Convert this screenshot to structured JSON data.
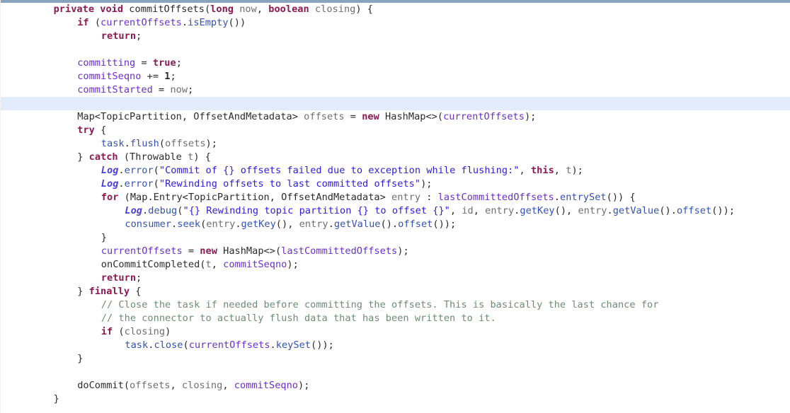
{
  "editor": {
    "language": "java",
    "method_name": "commitOffsets",
    "caret_line_index": 7,
    "colors": {
      "background": "#ffffff",
      "caret_line_highlight": "#e3ecfa",
      "top_strip": "#8aa4bd",
      "keyword": "#8a1a50",
      "field": "#6a31c9",
      "static_field": "#4b3fd6",
      "identifier": "#3451b2",
      "local_variable": "#6f6f6f",
      "string": "#2f20d6",
      "comment": "#6e8b74",
      "plain_text": "#2b2b2b"
    }
  },
  "lines": [
    {
      "id": 0,
      "indent": 1,
      "highlight": false,
      "tokens": [
        {
          "t": "private",
          "c": "kw"
        },
        {
          "t": " ",
          "c": "plain"
        },
        {
          "t": "void",
          "c": "kw"
        },
        {
          "t": " ",
          "c": "plain"
        },
        {
          "t": "commitOffsets",
          "c": "plain"
        },
        {
          "t": "(",
          "c": "plain"
        },
        {
          "t": "long",
          "c": "kw"
        },
        {
          "t": " ",
          "c": "plain"
        },
        {
          "t": "now",
          "c": "local"
        },
        {
          "t": ", ",
          "c": "plain"
        },
        {
          "t": "boolean",
          "c": "kw"
        },
        {
          "t": " ",
          "c": "plain"
        },
        {
          "t": "closing",
          "c": "local"
        },
        {
          "t": ") {",
          "c": "plain"
        }
      ]
    },
    {
      "id": 1,
      "indent": 2,
      "highlight": false,
      "tokens": [
        {
          "t": "if",
          "c": "kw"
        },
        {
          "t": " (",
          "c": "plain"
        },
        {
          "t": "currentOffsets",
          "c": "field"
        },
        {
          "t": ".",
          "c": "plain"
        },
        {
          "t": "isEmpty",
          "c": "ident"
        },
        {
          "t": "())",
          "c": "plain"
        }
      ]
    },
    {
      "id": 2,
      "indent": 3,
      "highlight": false,
      "tokens": [
        {
          "t": "return",
          "c": "kw"
        },
        {
          "t": ";",
          "c": "plain"
        }
      ]
    },
    {
      "id": 3,
      "indent": 0,
      "highlight": false,
      "tokens": []
    },
    {
      "id": 4,
      "indent": 2,
      "highlight": false,
      "tokens": [
        {
          "t": "committing",
          "c": "field"
        },
        {
          "t": " = ",
          "c": "plain"
        },
        {
          "t": "true",
          "c": "kw"
        },
        {
          "t": ";",
          "c": "plain"
        }
      ]
    },
    {
      "id": 5,
      "indent": 2,
      "highlight": false,
      "tokens": [
        {
          "t": "commitSeqno",
          "c": "field"
        },
        {
          "t": " += ",
          "c": "plain"
        },
        {
          "t": "1",
          "c": "num"
        },
        {
          "t": ";",
          "c": "plain"
        }
      ]
    },
    {
      "id": 6,
      "indent": 2,
      "highlight": false,
      "tokens": [
        {
          "t": "commitStarted",
          "c": "field"
        },
        {
          "t": " = ",
          "c": "plain"
        },
        {
          "t": "now",
          "c": "local"
        },
        {
          "t": ";",
          "c": "plain"
        }
      ]
    },
    {
      "id": 7,
      "indent": 0,
      "highlight": true,
      "tokens": []
    },
    {
      "id": 8,
      "indent": 2,
      "highlight": false,
      "tokens": [
        {
          "t": "Map<TopicPartition, OffsetAndMetadata> ",
          "c": "plain"
        },
        {
          "t": "offsets",
          "c": "local"
        },
        {
          "t": " = ",
          "c": "plain"
        },
        {
          "t": "new",
          "c": "kw"
        },
        {
          "t": " HashMap<>(",
          "c": "plain"
        },
        {
          "t": "currentOffsets",
          "c": "field"
        },
        {
          "t": ");",
          "c": "plain"
        }
      ]
    },
    {
      "id": 9,
      "indent": 2,
      "highlight": false,
      "tokens": [
        {
          "t": "try",
          "c": "kw"
        },
        {
          "t": " {",
          "c": "plain"
        }
      ]
    },
    {
      "id": 10,
      "indent": 3,
      "highlight": false,
      "tokens": [
        {
          "t": "task",
          "c": "ident"
        },
        {
          "t": ".",
          "c": "plain"
        },
        {
          "t": "flush",
          "c": "ident"
        },
        {
          "t": "(",
          "c": "plain"
        },
        {
          "t": "offsets",
          "c": "local"
        },
        {
          "t": ");",
          "c": "plain"
        }
      ]
    },
    {
      "id": 11,
      "indent": 2,
      "highlight": false,
      "tokens": [
        {
          "t": "} ",
          "c": "plain"
        },
        {
          "t": "catch",
          "c": "kw"
        },
        {
          "t": " (Throwable ",
          "c": "plain"
        },
        {
          "t": "t",
          "c": "local"
        },
        {
          "t": ") {",
          "c": "plain"
        }
      ]
    },
    {
      "id": 12,
      "indent": 3,
      "highlight": false,
      "tokens": [
        {
          "t": "Log",
          "c": "sfield"
        },
        {
          "t": ".",
          "c": "plain"
        },
        {
          "t": "error",
          "c": "ident"
        },
        {
          "t": "(",
          "c": "plain"
        },
        {
          "t": "\"Commit of {} offsets failed due to exception while flushing:\"",
          "c": "str"
        },
        {
          "t": ", ",
          "c": "plain"
        },
        {
          "t": "this",
          "c": "kw"
        },
        {
          "t": ", ",
          "c": "plain"
        },
        {
          "t": "t",
          "c": "local"
        },
        {
          "t": ");",
          "c": "plain"
        }
      ]
    },
    {
      "id": 13,
      "indent": 3,
      "highlight": false,
      "tokens": [
        {
          "t": "Log",
          "c": "sfield"
        },
        {
          "t": ".",
          "c": "plain"
        },
        {
          "t": "error",
          "c": "ident"
        },
        {
          "t": "(",
          "c": "plain"
        },
        {
          "t": "\"Rewinding offsets to last committed offsets\"",
          "c": "str"
        },
        {
          "t": ");",
          "c": "plain"
        }
      ]
    },
    {
      "id": 14,
      "indent": 3,
      "highlight": false,
      "tokens": [
        {
          "t": "for",
          "c": "kw"
        },
        {
          "t": " (Map.Entry<TopicPartition, OffsetAndMetadata> ",
          "c": "plain"
        },
        {
          "t": "entry",
          "c": "local"
        },
        {
          "t": " : ",
          "c": "plain"
        },
        {
          "t": "lastCommittedOffsets",
          "c": "field"
        },
        {
          "t": ".",
          "c": "plain"
        },
        {
          "t": "entrySet",
          "c": "ident"
        },
        {
          "t": "()) {",
          "c": "plain"
        }
      ]
    },
    {
      "id": 15,
      "indent": 4,
      "highlight": false,
      "tokens": [
        {
          "t": "Log",
          "c": "sfield"
        },
        {
          "t": ".",
          "c": "plain"
        },
        {
          "t": "debug",
          "c": "ident"
        },
        {
          "t": "(",
          "c": "plain"
        },
        {
          "t": "\"{} Rewinding topic partition {} to offset {}\"",
          "c": "str"
        },
        {
          "t": ", ",
          "c": "plain"
        },
        {
          "t": "id",
          "c": "local"
        },
        {
          "t": ", ",
          "c": "plain"
        },
        {
          "t": "entry",
          "c": "local"
        },
        {
          "t": ".",
          "c": "plain"
        },
        {
          "t": "getKey",
          "c": "ident"
        },
        {
          "t": "(), ",
          "c": "plain"
        },
        {
          "t": "entry",
          "c": "local"
        },
        {
          "t": ".",
          "c": "plain"
        },
        {
          "t": "getValue",
          "c": "ident"
        },
        {
          "t": "().",
          "c": "plain"
        },
        {
          "t": "offset",
          "c": "ident"
        },
        {
          "t": "());",
          "c": "plain"
        }
      ]
    },
    {
      "id": 16,
      "indent": 4,
      "highlight": false,
      "tokens": [
        {
          "t": "consumer",
          "c": "ident"
        },
        {
          "t": ".",
          "c": "plain"
        },
        {
          "t": "seek",
          "c": "ident"
        },
        {
          "t": "(",
          "c": "plain"
        },
        {
          "t": "entry",
          "c": "local"
        },
        {
          "t": ".",
          "c": "plain"
        },
        {
          "t": "getKey",
          "c": "ident"
        },
        {
          "t": "(), ",
          "c": "plain"
        },
        {
          "t": "entry",
          "c": "local"
        },
        {
          "t": ".",
          "c": "plain"
        },
        {
          "t": "getValue",
          "c": "ident"
        },
        {
          "t": "().",
          "c": "plain"
        },
        {
          "t": "offset",
          "c": "ident"
        },
        {
          "t": "());",
          "c": "plain"
        }
      ]
    },
    {
      "id": 17,
      "indent": 3,
      "highlight": false,
      "tokens": [
        {
          "t": "}",
          "c": "plain"
        }
      ]
    },
    {
      "id": 18,
      "indent": 3,
      "highlight": false,
      "tokens": [
        {
          "t": "currentOffsets",
          "c": "field"
        },
        {
          "t": " = ",
          "c": "plain"
        },
        {
          "t": "new",
          "c": "kw"
        },
        {
          "t": " HashMap<>(",
          "c": "plain"
        },
        {
          "t": "lastCommittedOffsets",
          "c": "field"
        },
        {
          "t": ");",
          "c": "plain"
        }
      ]
    },
    {
      "id": 19,
      "indent": 3,
      "highlight": false,
      "tokens": [
        {
          "t": "onCommitCompleted",
          "c": "plain"
        },
        {
          "t": "(",
          "c": "plain"
        },
        {
          "t": "t",
          "c": "local"
        },
        {
          "t": ", ",
          "c": "plain"
        },
        {
          "t": "commitSeqno",
          "c": "field"
        },
        {
          "t": ");",
          "c": "plain"
        }
      ]
    },
    {
      "id": 20,
      "indent": 3,
      "highlight": false,
      "tokens": [
        {
          "t": "return",
          "c": "kw"
        },
        {
          "t": ";",
          "c": "plain"
        }
      ]
    },
    {
      "id": 21,
      "indent": 2,
      "highlight": false,
      "tokens": [
        {
          "t": "} ",
          "c": "plain"
        },
        {
          "t": "finally",
          "c": "kw"
        },
        {
          "t": " {",
          "c": "plain"
        }
      ]
    },
    {
      "id": 22,
      "indent": 3,
      "highlight": false,
      "tokens": [
        {
          "t": "// Close the task if needed before committing the offsets. This is basically the last chance for",
          "c": "cmt"
        }
      ]
    },
    {
      "id": 23,
      "indent": 3,
      "highlight": false,
      "tokens": [
        {
          "t": "// the connector to actually flush data that has been written to it.",
          "c": "cmt"
        }
      ]
    },
    {
      "id": 24,
      "indent": 3,
      "highlight": false,
      "tokens": [
        {
          "t": "if",
          "c": "kw"
        },
        {
          "t": " (",
          "c": "plain"
        },
        {
          "t": "closing",
          "c": "local"
        },
        {
          "t": ")",
          "c": "plain"
        }
      ]
    },
    {
      "id": 25,
      "indent": 4,
      "highlight": false,
      "tokens": [
        {
          "t": "task",
          "c": "ident"
        },
        {
          "t": ".",
          "c": "plain"
        },
        {
          "t": "close",
          "c": "ident"
        },
        {
          "t": "(",
          "c": "plain"
        },
        {
          "t": "currentOffsets",
          "c": "field"
        },
        {
          "t": ".",
          "c": "plain"
        },
        {
          "t": "keySet",
          "c": "ident"
        },
        {
          "t": "());",
          "c": "plain"
        }
      ]
    },
    {
      "id": 26,
      "indent": 2,
      "highlight": false,
      "tokens": [
        {
          "t": "}",
          "c": "plain"
        }
      ]
    },
    {
      "id": 27,
      "indent": 0,
      "highlight": false,
      "tokens": []
    },
    {
      "id": 28,
      "indent": 2,
      "highlight": false,
      "tokens": [
        {
          "t": "doCommit",
          "c": "plain"
        },
        {
          "t": "(",
          "c": "plain"
        },
        {
          "t": "offsets",
          "c": "local"
        },
        {
          "t": ", ",
          "c": "plain"
        },
        {
          "t": "closing",
          "c": "local"
        },
        {
          "t": ", ",
          "c": "plain"
        },
        {
          "t": "commitSeqno",
          "c": "field"
        },
        {
          "t": ");",
          "c": "plain"
        }
      ]
    },
    {
      "id": 29,
      "indent": 1,
      "highlight": false,
      "tokens": [
        {
          "t": "}",
          "c": "plain"
        }
      ]
    }
  ]
}
